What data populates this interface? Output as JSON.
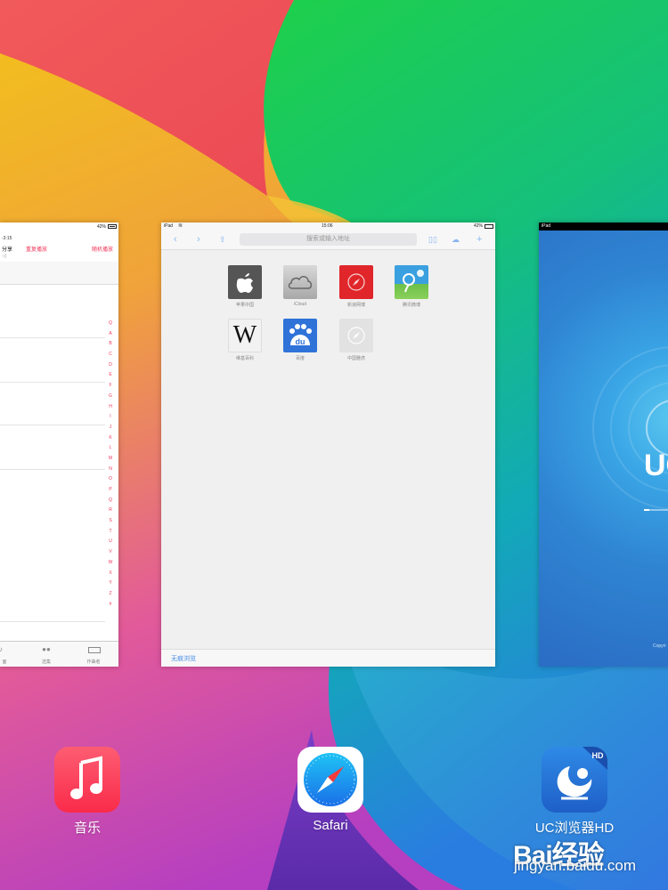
{
  "music_card": {
    "status_time": "-3:15",
    "status_battery": "42%",
    "title": "分享",
    "recent_label": "重复播放",
    "shuffle_label": "随机播放",
    "sub_text": "◁)",
    "index_letters": [
      "Q",
      "A",
      "B",
      "C",
      "D",
      "E",
      "F",
      "G",
      "H",
      "I",
      "J",
      "K",
      "L",
      "M",
      "N",
      "O",
      "P",
      "Q",
      "R",
      "S",
      "T",
      "U",
      "V",
      "W",
      "X",
      "Y",
      "Z",
      "#"
    ],
    "tabs": [
      {
        "label": "面",
        "icon": "music-note-icon"
      },
      {
        "label": "选集",
        "icon": "people-icon"
      },
      {
        "label": "作曲者",
        "icon": "piano-icon"
      }
    ]
  },
  "safari_card": {
    "status_device": "iPad",
    "status_time": "15:06",
    "status_battery": "42%",
    "address_placeholder": "搜索或输入地址",
    "favorites": [
      {
        "label": "苹果中国",
        "icon": "apple-icon",
        "color": "#555555"
      },
      {
        "label": "iCloud",
        "icon": "icloud-icon",
        "color": "#b8b8b8"
      },
      {
        "label": "新浪网博",
        "icon": "compass-icon",
        "color": "#e0262a"
      },
      {
        "label": "腾讯微博",
        "icon": "tencent-weibo-icon",
        "color": "#3a9ad8"
      },
      {
        "label": "维基百科",
        "icon": "wikipedia-icon",
        "color": "#f2f2f2"
      },
      {
        "label": "百度",
        "icon": "baidu-icon",
        "color": "#2f73d9"
      },
      {
        "label": "中国雅虎",
        "icon": "compass-icon",
        "color": "#e2e2e2"
      }
    ],
    "private_label": "无痕浏览"
  },
  "uc_card": {
    "status_device": "iPad",
    "logo_text": "UC",
    "progress": 0.15,
    "copyright": "Copyri"
  },
  "dock": {
    "apps": [
      {
        "label": "音乐",
        "icon": "music-icon"
      },
      {
        "label": "Safari",
        "icon": "safari-icon"
      },
      {
        "label": "UC浏览器HD",
        "icon": "uc-browser-icon"
      }
    ]
  },
  "watermark": {
    "logo": "Bai经验",
    "url": "jingyan.baidu.com"
  }
}
